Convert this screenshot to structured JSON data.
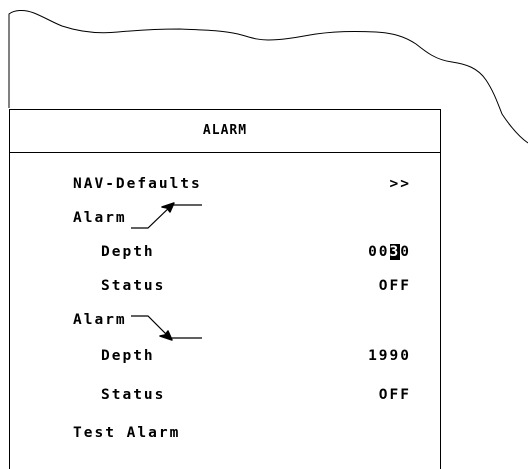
{
  "window": {
    "title": "ALARM"
  },
  "menu": {
    "nav_defaults": {
      "label": "NAV-Defaults",
      "value": ">>"
    },
    "alarm_shallow": {
      "label": "Alarm",
      "icon": "arrow-up-right-icon",
      "depth": {
        "label": "Depth",
        "value_prefix": "00",
        "value_cursor": "3",
        "value_suffix": "0"
      },
      "status": {
        "label": "Status",
        "value": "OFF"
      }
    },
    "alarm_deep": {
      "label": "Alarm",
      "icon": "arrow-down-right-icon",
      "depth": {
        "label": "Depth",
        "value": "1990"
      },
      "status": {
        "label": "Status",
        "value": "OFF"
      }
    },
    "test_alarm": {
      "label": "Test Alarm"
    }
  }
}
